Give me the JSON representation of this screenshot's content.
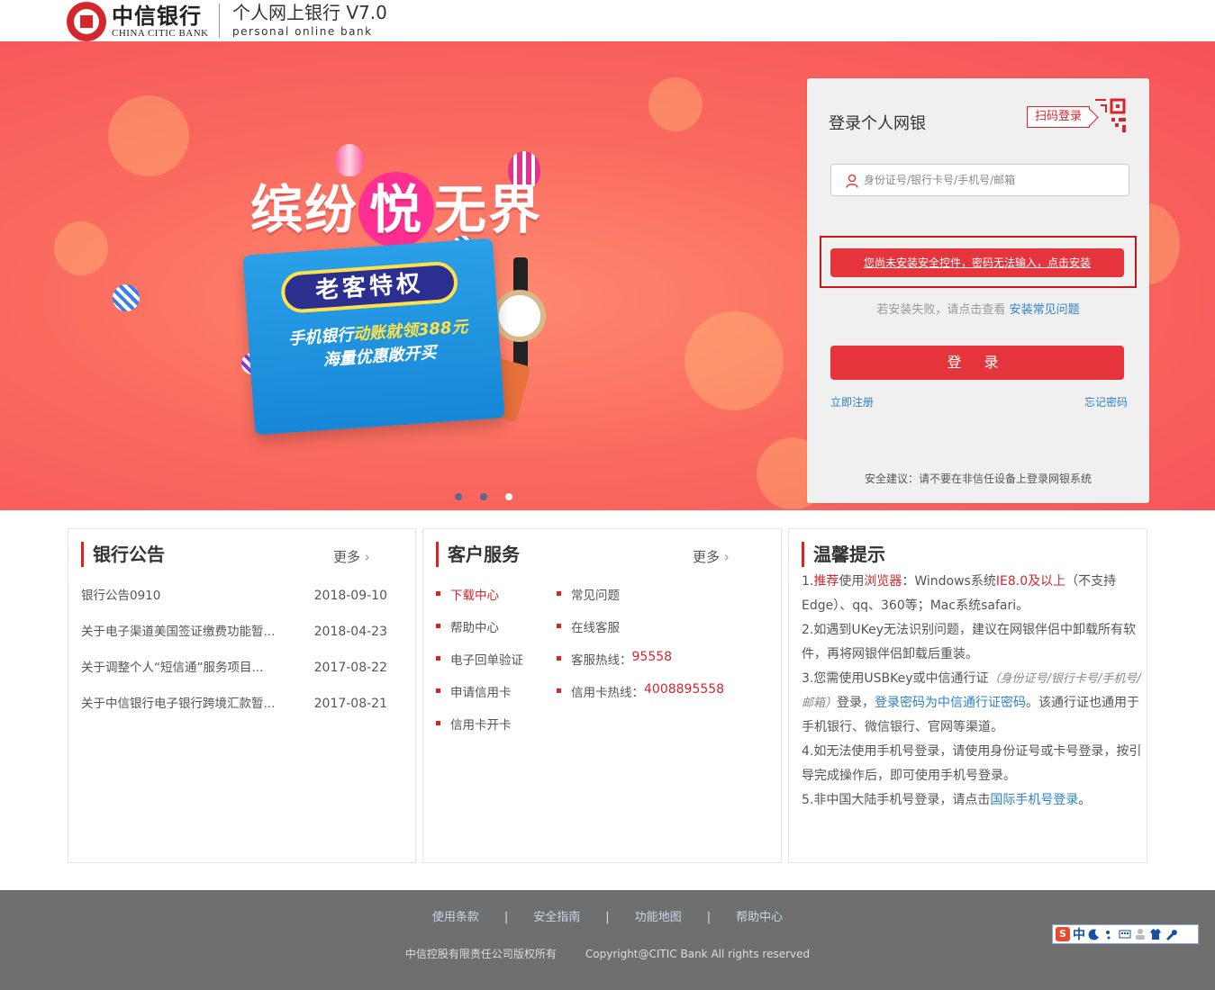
{
  "header": {
    "logo_cn": "中信银行",
    "logo_en": "CHINA CITIC BANK",
    "product_title": "个人网上银行 V7.0",
    "product_sub": "personal online bank"
  },
  "banner": {
    "title_a": "缤纷",
    "title_hl": "悦",
    "title_b": "无界",
    "pill": "老客特权",
    "line1_a": "手机银行",
    "line1_b": "动账就领388元",
    "line2": "海量优惠敞开买",
    "slide_count": 3,
    "active_slide": 3
  },
  "login": {
    "title": "登录个人网银",
    "qr_label": "扫码登录",
    "username_placeholder": "身份证号/银行卡号/手机号/邮箱",
    "install_prompt": "您尚未安装安全控件，密码无法输入，点击安装",
    "install_hint": "若安装失败，请点击查看 ",
    "install_faq": "安装常见问题",
    "login_button": "登 录",
    "register_link": "立即注册",
    "forgot_link": "忘记密码",
    "security_tip": "安全建议：请不要在非信任设备上登录网银系统"
  },
  "notices": {
    "title": "银行公告",
    "more": "更多",
    "items": [
      {
        "title": "银行公告0910",
        "date": "2018-09-10"
      },
      {
        "title": "关于电子渠道美国签证缴费功能暂...",
        "date": "2018-04-23"
      },
      {
        "title": "关于调整个人“短信通”服务项目...",
        "date": "2017-08-22"
      },
      {
        "title": "关于中信银行电子银行跨境汇款暂...",
        "date": "2017-08-21"
      }
    ]
  },
  "service": {
    "title": "客户服务",
    "more": "更多",
    "left": [
      "下载中心",
      "帮助中心",
      "电子回单验证",
      "申请信用卡",
      "信用卡开卡"
    ],
    "right_1": "常见问题",
    "right_2": "在线客服",
    "hotline_label": "客服热线：",
    "hotline": "95558",
    "card_hotline_label": "信用卡热线：",
    "card_hotline": "4008895558"
  },
  "tips": {
    "title": "温馨提示",
    "t1_a": "1.",
    "t1_b": "推荐",
    "t1_c": "使用",
    "t1_d": "浏览器",
    "t1_e": "：Windows系统",
    "t1_f": "IE8.0及以上",
    "t1_g": "（不支持Edge）、qq、360等；Mac系统safari。",
    "t2": "2.如遇到UKey无法识别问题，建议在网银伴侣中卸载所有软件，再将网银伴侣卸载后重装。",
    "t3_a": "3.您需使用USBKey或中信通行证",
    "t3_b": "（身份证号/银行卡号/手机号/邮箱）",
    "t3_c": "登录，",
    "t3_d": "登录密码为中信通行证密码",
    "t3_e": "。该通行证也通用于手机银行、微信银行、官网等渠道。",
    "t4": "4.如无法使用手机号登录，请使用身份证号或卡号登录，按引导完成操作后，即可使用手机号登录。",
    "t5_a": "5.非中国大陆手机号登录，请点击",
    "t5_b": "国际手机号登录",
    "t5_c": "。"
  },
  "footer": {
    "links": [
      "使用条款",
      "安全指南",
      "功能地图",
      "帮助中心"
    ],
    "separator": "|",
    "copy_cn": "中信控股有限责任公司版权所有",
    "copy_en": "Copyright@CITIC Bank All rights reserved"
  },
  "ime": {
    "logo": "S",
    "mode": "中",
    "icons": [
      "moon-icon",
      "punctuation-icon",
      "keyboard-icon",
      "user-icon",
      "shirt-icon",
      "wrench-icon"
    ]
  }
}
